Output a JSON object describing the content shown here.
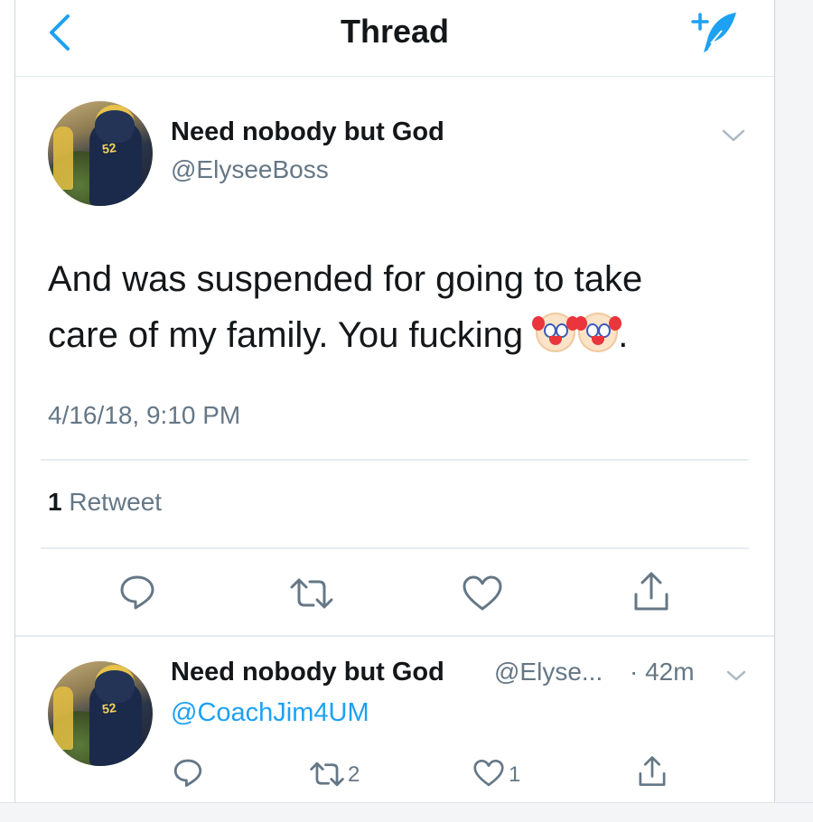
{
  "header": {
    "title": "Thread",
    "back_icon": "back-chevron-icon",
    "compose_icon": "compose-tweet-icon"
  },
  "main_tweet": {
    "author_name": "Need nobody but God",
    "handle": "@ElyseeBoss",
    "text_line1": "And was suspended for going to take",
    "text_line2": "care of my family. You fucking",
    "text_end": ".",
    "emojis": [
      "clown-face-emoji",
      "clown-face-emoji"
    ],
    "timestamp": "4/16/18, 9:10 PM",
    "retweet_count": "1",
    "retweet_label": "Retweet"
  },
  "reply_tweet": {
    "author_name": "Need nobody but God",
    "handle_truncated": "@Elyse...",
    "time_ago": "· 42m",
    "mention": "@CoachJim4UM",
    "retweet_count": "2",
    "like_count": "1"
  },
  "colors": {
    "accent": "#1da1f2",
    "text": "#14171a",
    "secondary": "#657786",
    "divider": "#e6ecf0"
  }
}
